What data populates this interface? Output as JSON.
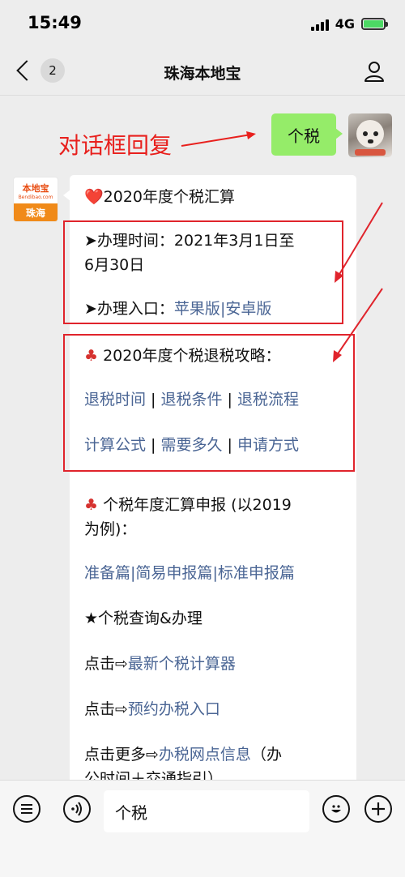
{
  "status_bar": {
    "time": "15:49",
    "network": "4G"
  },
  "nav": {
    "unread_count": "2",
    "title": "珠海本地宝"
  },
  "annotation": "对话框回复",
  "outgoing_message": "个税",
  "bot": {
    "brand": "本地宝",
    "brand_sub": "Bendibao.com",
    "city": "珠海"
  },
  "message": {
    "heading_icon": "❤️",
    "heading": "2020年度个税汇算",
    "time_label": "➤办理时间：2021年3月1日至",
    "time_label_2": "6月30日",
    "entry_label": "➤办理入口：",
    "entry_links": [
      "苹果版",
      "安卓版"
    ],
    "guide_title": "2020年度个税退税攻略：",
    "guide_links_row1": [
      "退税时间",
      "退税条件",
      "退税流程"
    ],
    "guide_links_row2": [
      "计算公式",
      "需要多久",
      "申请方式"
    ],
    "report_title": "个税年度汇算申报 (以2019",
    "report_title_2": "为例)：",
    "report_links": [
      "准备篇",
      "简易申报篇",
      "标准申报篇"
    ],
    "query_title": "★个税查询&办理",
    "click_prefix": "点击⇨",
    "calc_link": "最新个税计算器",
    "reserve_link": "预约办税入口",
    "more_prefix": "点击更多⇨",
    "more_link": "办税网点信息",
    "more_suffix": "（办",
    "more_suffix_2": "公时间＋交通指引）",
    "separator": "|",
    "spaced_separator": " | "
  },
  "input": {
    "value": "个税"
  },
  "colors": {
    "bubble_out": "#95ec69",
    "link": "#4a6594",
    "annotation": "#e8201d",
    "highlight_box": "#e0242c"
  }
}
